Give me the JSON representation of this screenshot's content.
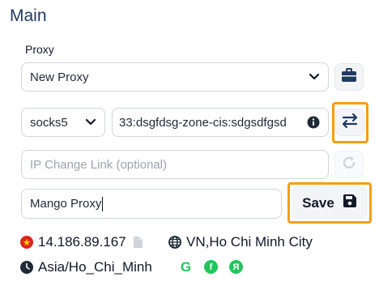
{
  "section": {
    "title": "Main"
  },
  "proxy": {
    "label": "Proxy",
    "selected": "New Proxy",
    "protocol": "socks5",
    "credentials": "33:dsgfdsg-zone-cis:sdgsdfgsd",
    "ip_change_placeholder": "IP Change Link (optional)",
    "name_value": "Mango Proxy",
    "save_label": "Save"
  },
  "info": {
    "ip": "14.186.89.167",
    "location": "VN,Ho Chi Minh City",
    "timezone": "Asia/Ho_Chi_Minh",
    "social_g": "G",
    "social_f": "f",
    "social_ya": "Я"
  },
  "colors": {
    "highlight": "#f59e0b",
    "social_green": "#22c55e",
    "title": "#1e3a5f"
  }
}
